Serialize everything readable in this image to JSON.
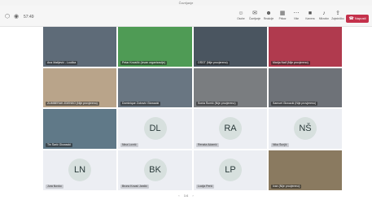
{
  "window": {
    "title": "Čavrljanje"
  },
  "toolbar": {
    "timer": "57:49",
    "buttons": [
      {
        "label": "Osobe",
        "icon": "people-icon"
      },
      {
        "label": "Čavrljanje",
        "icon": "chat-icon"
      },
      {
        "label": "Reakcije",
        "icon": "reactions-icon"
      },
      {
        "label": "Prikaz",
        "icon": "view-icon"
      },
      {
        "label": "Više",
        "icon": "more-icon"
      },
      {
        "label": "Kamera",
        "icon": "camera-icon"
      },
      {
        "label": "Mikrofon",
        "icon": "mic-icon"
      },
      {
        "label": "Zajedničko",
        "icon": "share-icon"
      }
    ],
    "leave_label": "Napusti"
  },
  "tiles": [
    {
      "name": "Ana Matijević - Loučka",
      "kind": "video",
      "color": "#5e6b78"
    },
    {
      "name": "Petar Kovačić (Izvan organizacije)",
      "kind": "video",
      "color": "#4f9b55"
    },
    {
      "name": "OŠGT (Nije provjereno)",
      "kind": "video",
      "color": "#4a5560"
    },
    {
      "name": "Marija Nađ (Nije provjereno)",
      "kind": "video",
      "color": "#b03a4e"
    },
    {
      "name": "ZUMBERAK ZDENKO (Nije provjereno)",
      "kind": "video",
      "color": "#b9a48a"
    },
    {
      "name": "Dominique Zubović Glowacki",
      "kind": "video",
      "color": "#697682"
    },
    {
      "name": "Sonia Šumić (Nije provjereno)",
      "kind": "video",
      "color": "#7a7d80"
    },
    {
      "name": "Samuel Glovacki (Nije provjereno)",
      "kind": "video",
      "color": "#6e7278"
    },
    {
      "name": "Tin Šarić Glowacki",
      "kind": "video",
      "color": "#607988"
    },
    {
      "name": "Nina Lovrić",
      "kind": "avatar",
      "initials": "DL"
    },
    {
      "name": "Renata Adamić",
      "kind": "avatar",
      "initials": "RA"
    },
    {
      "name": "Nika Šunjić",
      "kind": "avatar",
      "initials": "NŠ"
    },
    {
      "name": "Jura Novko",
      "kind": "avatar",
      "initials": "LN"
    },
    {
      "name": "Bruno Kovač Jančić",
      "kind": "avatar",
      "initials": "BK"
    },
    {
      "name": "Lucija Perić",
      "kind": "avatar",
      "initials": "LP"
    },
    {
      "name": "Ivan (Nije provjereno)",
      "kind": "video",
      "color": "#8a7a60"
    }
  ],
  "pagination": {
    "text": "1/4"
  }
}
